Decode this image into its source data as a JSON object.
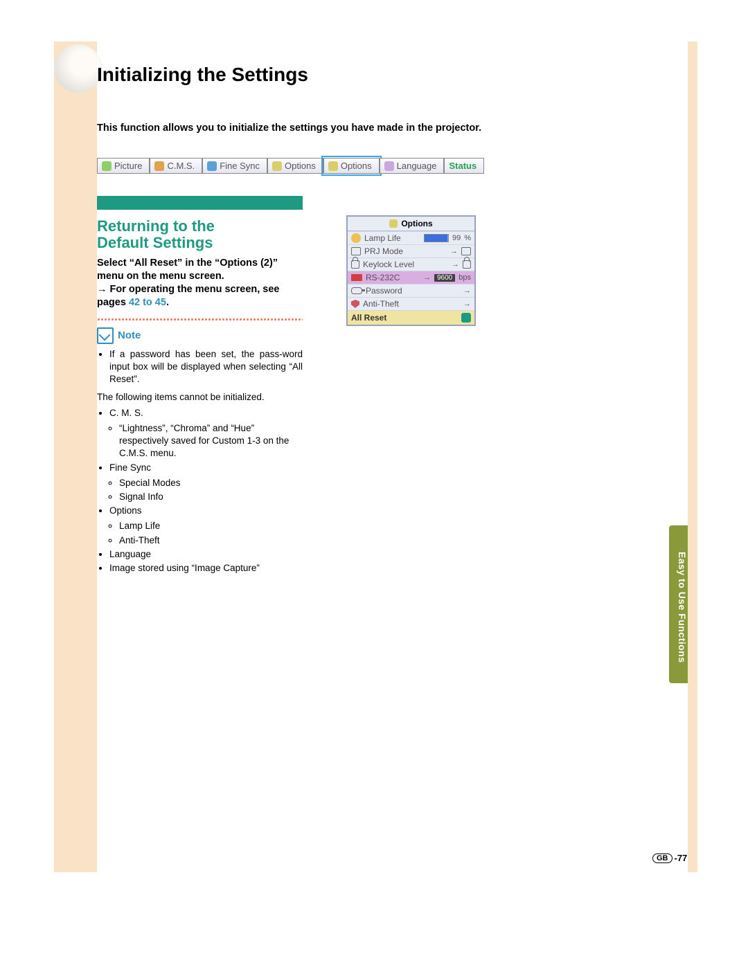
{
  "title": "Initializing the Settings",
  "intro": "This function allows you to initialize the settings you have made in the projector.",
  "tabs": {
    "picture": "Picture",
    "cms": "C.M.S.",
    "finesync": "Fine Sync",
    "options1": "Options",
    "options2": "Options",
    "language": "Language",
    "status": "Status"
  },
  "section": {
    "heading_line1": "Returning to the",
    "heading_line2": "Default Settings",
    "instr1": "Select “All Reset” in the “Options (2)” menu on the menu screen.",
    "instr2_prefix": "→ For operating the menu screen, see pages ",
    "instr2_link": "42 to 45",
    "instr2_suffix": "."
  },
  "note": {
    "label": "Note",
    "bullet1": "If a password has been set, the pass-word input box will be displayed when selecting “All Reset”.",
    "lead": "The following items cannot be initialized.",
    "i1": "C. M. S.",
    "i1a": "“Lightness”, “Chroma” and “Hue” respectively saved for Custom 1-3 on the C.M.S. menu.",
    "i2": "Fine Sync",
    "i2a": "Special Modes",
    "i2b": "Signal Info",
    "i3": "Options",
    "i3a": "Lamp Life",
    "i3b": "Anti-Theft",
    "i4": "Language",
    "i5": "Image stored using “Image Capture”"
  },
  "panel": {
    "header": "Options",
    "lamp": {
      "label": "Lamp Life",
      "value": "99",
      "unit": "%"
    },
    "prj": {
      "label": "PRJ Mode"
    },
    "keylock": {
      "label": "Keylock Level"
    },
    "rs232c": {
      "label": "RS-232C",
      "value": "9600",
      "unit": "bps"
    },
    "password": {
      "label": "Password"
    },
    "antitheft": {
      "label": "Anti-Theft"
    },
    "allreset": {
      "label": "All Reset"
    }
  },
  "side_tab": "Easy to Use Functions",
  "page_region": "GB",
  "page_number": "-77"
}
